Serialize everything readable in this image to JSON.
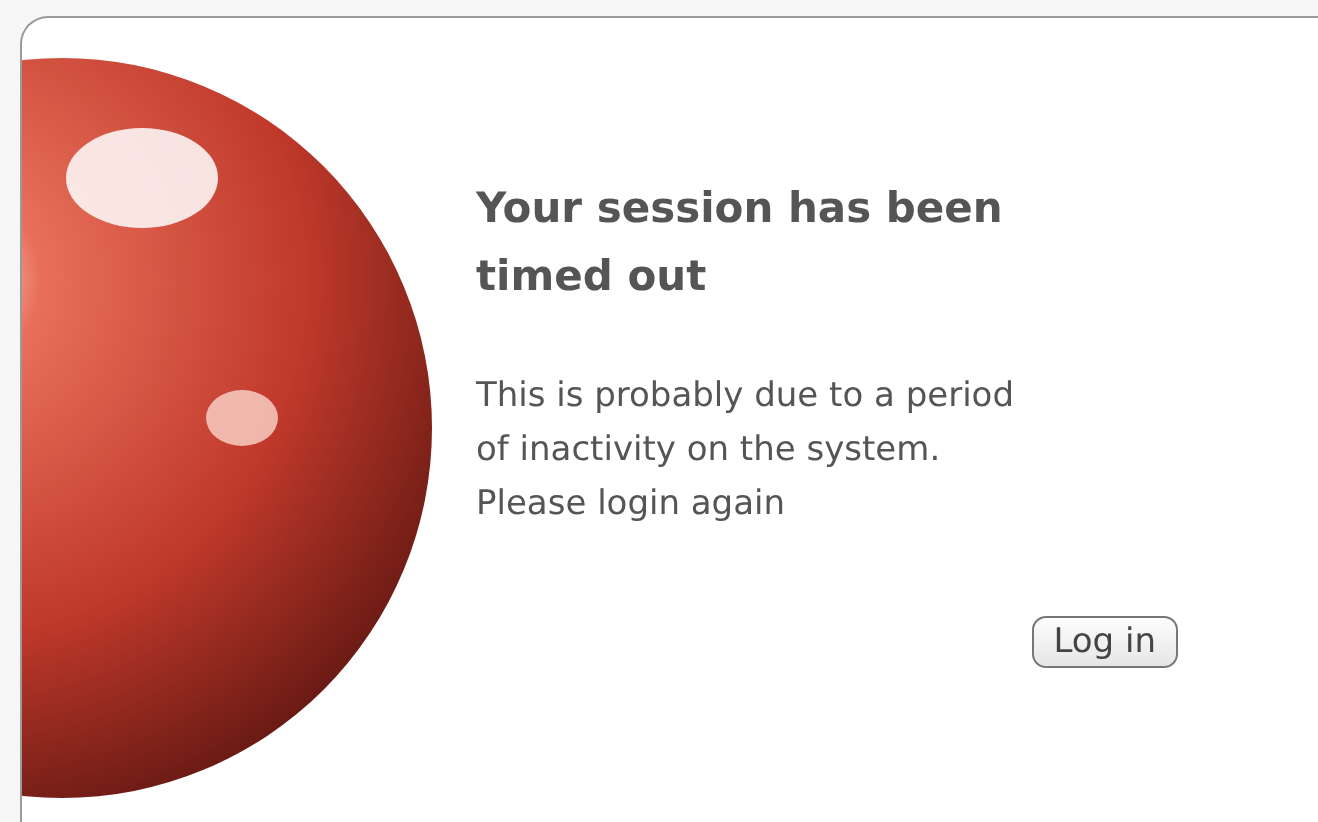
{
  "dialog": {
    "title": "Your session has been timed out",
    "message_lines": [
      "This is probably due to a period",
      "of inactivity on the system.",
      "Please login again"
    ],
    "button": "Log in"
  }
}
